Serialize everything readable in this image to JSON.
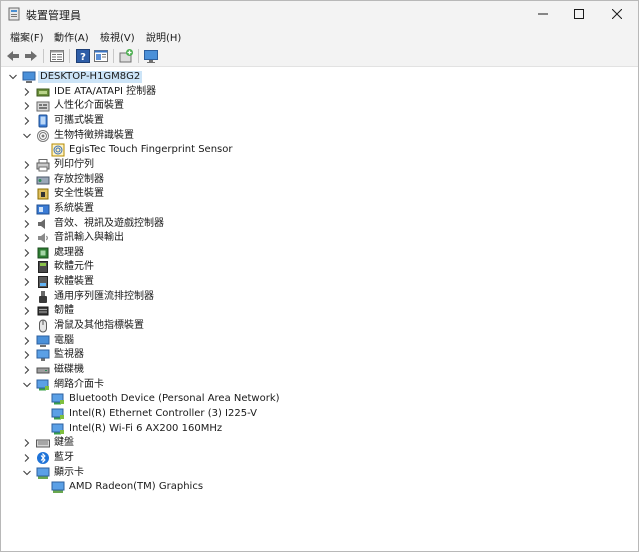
{
  "window": {
    "title": "裝置管理員"
  },
  "menu": [
    {
      "label": "檔案(F)"
    },
    {
      "label": "動作(A)"
    },
    {
      "label": "檢視(V)"
    },
    {
      "label": "說明(H)"
    }
  ],
  "toolbar": {
    "buttons": [
      "back-arrow-icon",
      "forward-arrow-icon",
      "properties-icon",
      "help-icon",
      "device-panel-icon",
      "update-driver-icon",
      "monitor-scan-icon"
    ]
  },
  "tree": {
    "root": "DESKTOP-H1GM8G2",
    "categories": [
      {
        "label": "IDE ATA/ATAPI 控制器",
        "expanded": false,
        "icon": "ide-controller-icon"
      },
      {
        "label": "人性化介面裝置",
        "expanded": false,
        "icon": "hid-icon"
      },
      {
        "label": "可攜式裝置",
        "expanded": false,
        "icon": "portable-device-icon"
      },
      {
        "label": "生物特徵辨識裝置",
        "expanded": true,
        "icon": "biometric-icon",
        "children": [
          {
            "label": "EgisTec Touch Fingerprint Sensor",
            "icon": "fingerprint-icon"
          }
        ]
      },
      {
        "label": "列印佇列",
        "expanded": false,
        "icon": "printer-icon"
      },
      {
        "label": "存放控制器",
        "expanded": false,
        "icon": "storage-controller-icon"
      },
      {
        "label": "安全性裝置",
        "expanded": false,
        "icon": "security-device-icon"
      },
      {
        "label": "系統裝置",
        "expanded": false,
        "icon": "system-device-icon"
      },
      {
        "label": "音效、視訊及遊戲控制器",
        "expanded": false,
        "icon": "sound-icon"
      },
      {
        "label": "音訊輸入與輸出",
        "expanded": false,
        "icon": "audio-io-icon"
      },
      {
        "label": "處理器",
        "expanded": false,
        "icon": "processor-icon"
      },
      {
        "label": "軟體元件",
        "expanded": false,
        "icon": "software-component-icon"
      },
      {
        "label": "軟體裝置",
        "expanded": false,
        "icon": "software-device-icon"
      },
      {
        "label": "通用序列匯流排控制器",
        "expanded": false,
        "icon": "usb-icon"
      },
      {
        "label": "韌體",
        "expanded": false,
        "icon": "firmware-icon"
      },
      {
        "label": "滑鼠及其他指標裝置",
        "expanded": false,
        "icon": "mouse-icon"
      },
      {
        "label": "電腦",
        "expanded": false,
        "icon": "computer-icon"
      },
      {
        "label": "監視器",
        "expanded": false,
        "icon": "monitor-icon"
      },
      {
        "label": "磁碟機",
        "expanded": false,
        "icon": "disk-drive-icon"
      },
      {
        "label": "網路介面卡",
        "expanded": true,
        "icon": "network-adapter-icon",
        "children": [
          {
            "label": "Bluetooth Device (Personal Area Network)",
            "icon": "network-adapter-icon"
          },
          {
            "label": "Intel(R) Ethernet Controller (3) I225-V",
            "icon": "network-adapter-icon"
          },
          {
            "label": "Intel(R) Wi-Fi 6 AX200 160MHz",
            "icon": "network-adapter-icon"
          }
        ]
      },
      {
        "label": "鍵盤",
        "expanded": false,
        "icon": "keyboard-icon"
      },
      {
        "label": "藍牙",
        "expanded": false,
        "icon": "bluetooth-icon"
      },
      {
        "label": "顯示卡",
        "expanded": true,
        "icon": "display-adapter-icon",
        "children": [
          {
            "label": "AMD Radeon(TM) Graphics",
            "icon": "display-adapter-icon"
          }
        ]
      }
    ]
  },
  "colors": {
    "selection": "#cce4f7",
    "chrome": "#f3f3f3",
    "accent": "#0067c0"
  }
}
